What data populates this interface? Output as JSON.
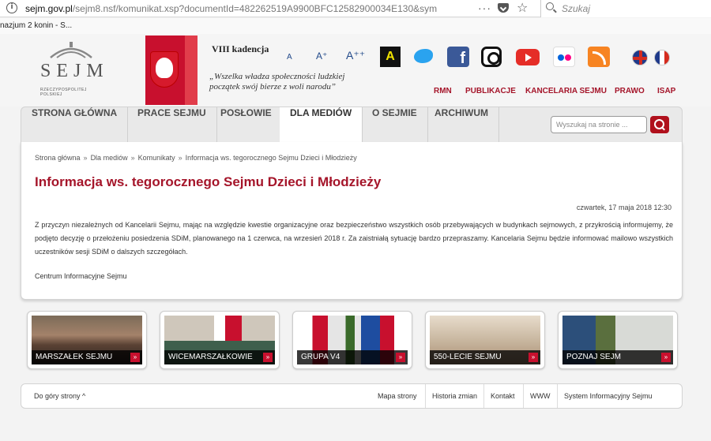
{
  "browser": {
    "url_domain": "sejm.gov.pl",
    "url_path": "/sejm8.nsf/komunikat.xsp?documentId=482262519A9900BFC12582900034E130&sym",
    "search_placeholder": "Szukaj",
    "bookmark": "nazjum 2 konin - S..."
  },
  "header": {
    "logo_text": "SEJM",
    "logo_subtitle": "RZECZYPOSPOLITEJ POLSKIEJ",
    "kadencja": "VIII kadencja",
    "motto_line1": "„Wszelka władza społeczności ludzkiej",
    "motto_line2": "początek swój bierze z woli narodu”",
    "font_small": "A",
    "font_medium": "A⁺",
    "font_large": "A⁺⁺",
    "contrast": "A",
    "facebook": "f",
    "top_links": [
      "RMN",
      "PUBLIKACJE",
      "KANCELARIA SEJMU",
      "PRAWO",
      "ISAP"
    ]
  },
  "nav": {
    "items": [
      "STRONA GŁÓWNA",
      "PRACE SEJMU",
      "POSŁOWIE",
      "DLA MEDIÓW",
      "O SEJMIE",
      "ARCHIWUM"
    ],
    "active": "DLA MEDIÓW",
    "search_placeholder": "Wyszukaj na stronie ..."
  },
  "breadcrumb": [
    "Strona główna",
    "Dla mediów",
    "Komunikaty",
    "Informacja ws. tegorocznego Sejmu Dzieci i Młodzieży"
  ],
  "breadcrumb_sep": "»",
  "article": {
    "title": "Informacja ws. tegorocznego Sejmu Dzieci i Młodzieży",
    "date": "czwartek, 17 maja 2018 12:30",
    "body": "Z przyczyn niezależnych od Kancelarii Sejmu, mając na względzie kwestie organizacyjne oraz bezpieczeństwo wszystkich osób przebywających w budynkach sejmowych, z przykrością informujemy, że podjęto decyzję o przełożeniu posiedzenia SDiM, planowanego na 1 czerwca, na wrzesień 2018 r. Za zaistniałą sytuację bardzo przepraszamy. Kancelaria Sejmu będzie informować mailowo wszystkich uczestników sesji SDiM o dalszych szczegółach.",
    "signature": "Centrum Informacyjne Sejmu"
  },
  "tiles": [
    "MARSZAŁEK SEJMU",
    "WICEMARSZAŁKOWIE",
    "GRUPA V4",
    "550-LECIE SEJMU",
    "POZNAJ SEJM"
  ],
  "tile_arrow": "»",
  "footer": {
    "back_to_top": "Do góry strony ^",
    "links": [
      "Mapa strony",
      "Historia zmian",
      "Kontakt",
      "WWW",
      "System Informacyjny Sejmu"
    ]
  },
  "colors": {
    "accent": "#a5152a",
    "nav_bg": "#e9e9e9"
  }
}
